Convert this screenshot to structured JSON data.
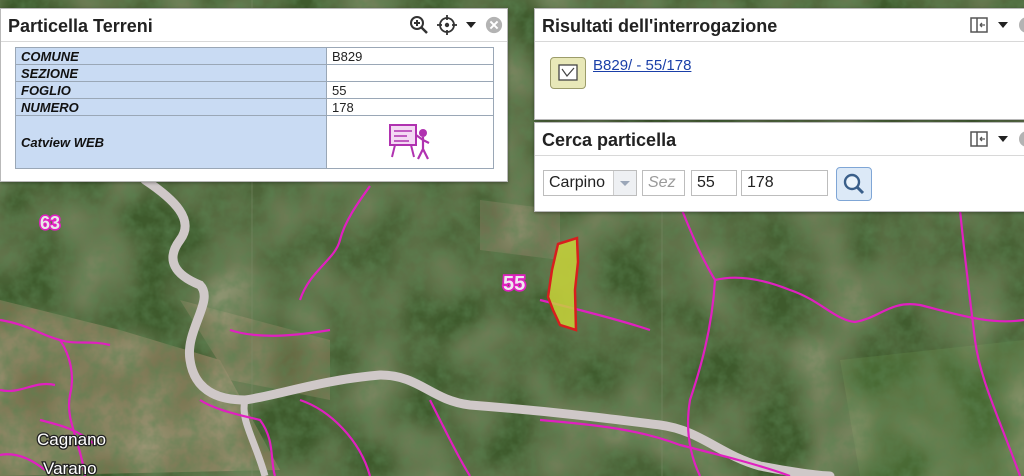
{
  "map": {
    "parcel_labels": [
      "63",
      "55"
    ],
    "place_label_line1": "Cagnano",
    "place_label_line2": "Varano",
    "colors": {
      "boundary": "#e020c0",
      "road": "#cfc8c8",
      "highlight_fill": "#c8d33a",
      "highlight_stroke": "#d81e1e"
    }
  },
  "particella_panel": {
    "title": "Particella Terreni",
    "icons": [
      "zoom-in-icon",
      "locate-icon",
      "dropdown-arrow-icon",
      "close-icon"
    ],
    "rows": [
      {
        "label": "COMUNE",
        "value": "B829"
      },
      {
        "label": "SEZIONE",
        "value": ""
      },
      {
        "label": "FOGLIO",
        "value": "55"
      },
      {
        "label": "NUMERO",
        "value": "178"
      }
    ],
    "catview_label": "Catview WEB"
  },
  "risultati_panel": {
    "title": "Risultati dell'interrogazione",
    "result_link": "B829/ - 55/178"
  },
  "cerca_panel": {
    "title": "Cerca particella",
    "comune_value": "Carpino",
    "sezione_placeholder": "Sez",
    "foglio_value": "55",
    "numero_value": "178"
  }
}
